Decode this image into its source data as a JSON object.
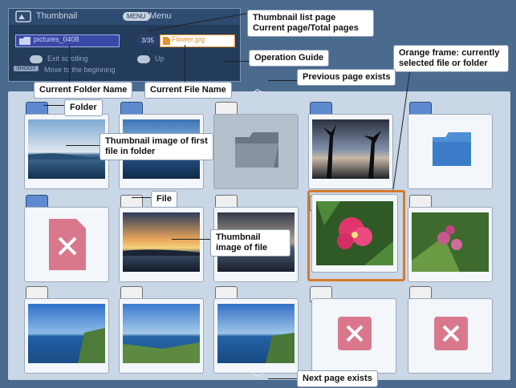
{
  "header": {
    "title": "Thumbnail",
    "menu_key": "MENU",
    "menu_label": "Menu",
    "folder_name": "pictures_0408",
    "page": "3/35",
    "file_name": "Flower.jpg",
    "guide_line1_a": "Exit scrolling",
    "guide_line1_b": "Up",
    "guide_line2": "Move to the beginning",
    "guide_key": "SHOOT"
  },
  "callouts": {
    "thumbnail_list": "Thumbnail list page",
    "current_total": "Current page/Total pages",
    "orange_frame": "Orange frame: currently selected file or folder",
    "operation_guide": "Operation Guide",
    "previous_page": "Previous page exists",
    "current_folder": "Current Folder Name",
    "current_file": "Current File Name",
    "folder": "Folder",
    "thumb_first": "Thumbnail image of first file in folder",
    "file": "File",
    "thumb_file": "Thumbnail image of file",
    "next_page": "Next page exists"
  }
}
